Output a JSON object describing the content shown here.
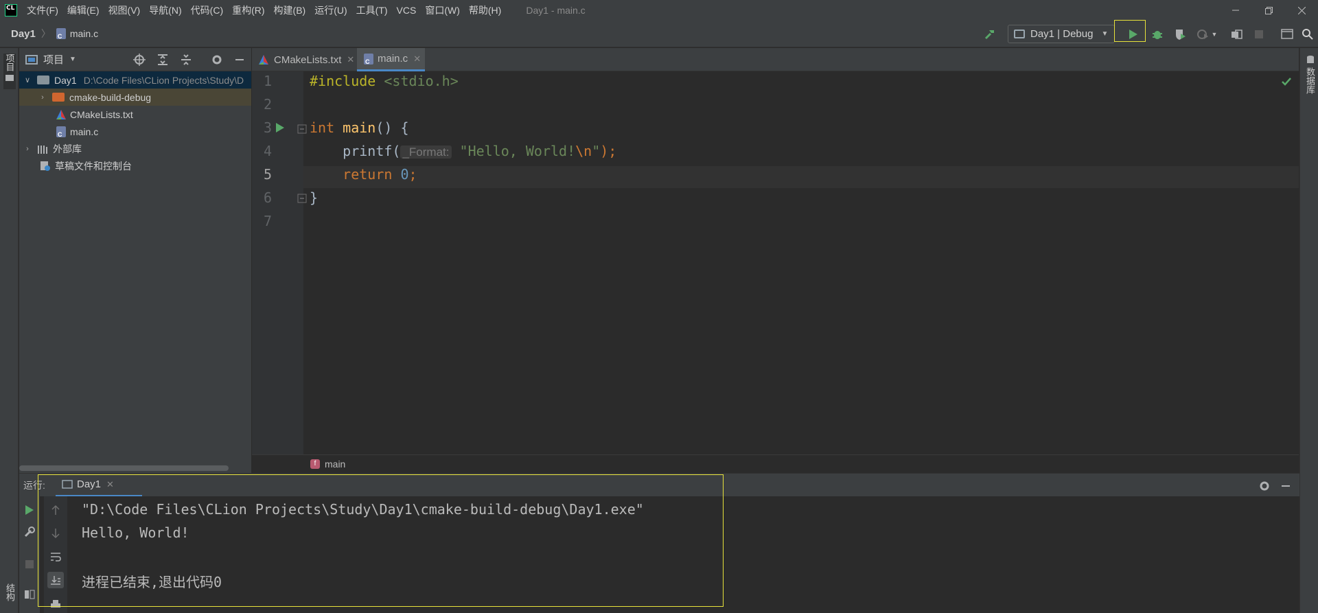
{
  "titlebar": {
    "logo_text": "CL",
    "menus": [
      "文件(F)",
      "编辑(E)",
      "视图(V)",
      "导航(N)",
      "代码(C)",
      "重构(R)",
      "构建(B)",
      "运行(U)",
      "工具(T)",
      "VCS",
      "窗口(W)",
      "帮助(H)"
    ],
    "window_title": "Day1 - main.c"
  },
  "navbar": {
    "project": "Day1",
    "file": "main.c",
    "run_config": "Day1 | Debug"
  },
  "left_strip": {
    "project_label": "项目",
    "structure_label": "结构"
  },
  "right_strip": {
    "db_label": "数据库"
  },
  "project_panel": {
    "title": "项目",
    "tree": [
      {
        "label": "Day1",
        "path": "D:\\Code Files\\CLion Projects\\Study\\D"
      },
      {
        "label": "cmake-build-debug"
      },
      {
        "label": "CMakeLists.txt"
      },
      {
        "label": "main.c"
      },
      {
        "label": "外部库"
      },
      {
        "label": "草稿文件和控制台"
      }
    ]
  },
  "editor": {
    "tabs": [
      {
        "label": "CMakeLists.txt"
      },
      {
        "label": "main.c"
      }
    ],
    "line_numbers": [
      "1",
      "2",
      "3",
      "4",
      "5",
      "6",
      "7"
    ],
    "code": {
      "l1_directive": "#include",
      "l1_header": "<stdio.h>",
      "l3_type": "int",
      "l3_name": "main",
      "l3_rest": "() {",
      "l4_call": "printf(",
      "l4_hint": "_Format:",
      "l4_str": "\"Hello, World!",
      "l4_esc": "\\n",
      "l4_str_end": "\"",
      "l4_end": ");",
      "l5_kw": "return",
      "l5_num": "0",
      "l5_end": ";",
      "l6": "}"
    },
    "breadcrumb_fn": "main"
  },
  "run_panel": {
    "label": "运行:",
    "tab": "Day1",
    "output": [
      "\"D:\\Code Files\\CLion Projects\\Study\\Day1\\cmake-build-debug\\Day1.exe\"",
      "Hello, World!",
      "",
      "进程已结束,退出代码0"
    ]
  },
  "colors": {
    "accent_highlight": "#e8e33b",
    "run_green": "#59a869",
    "selection": "#0d293e"
  }
}
